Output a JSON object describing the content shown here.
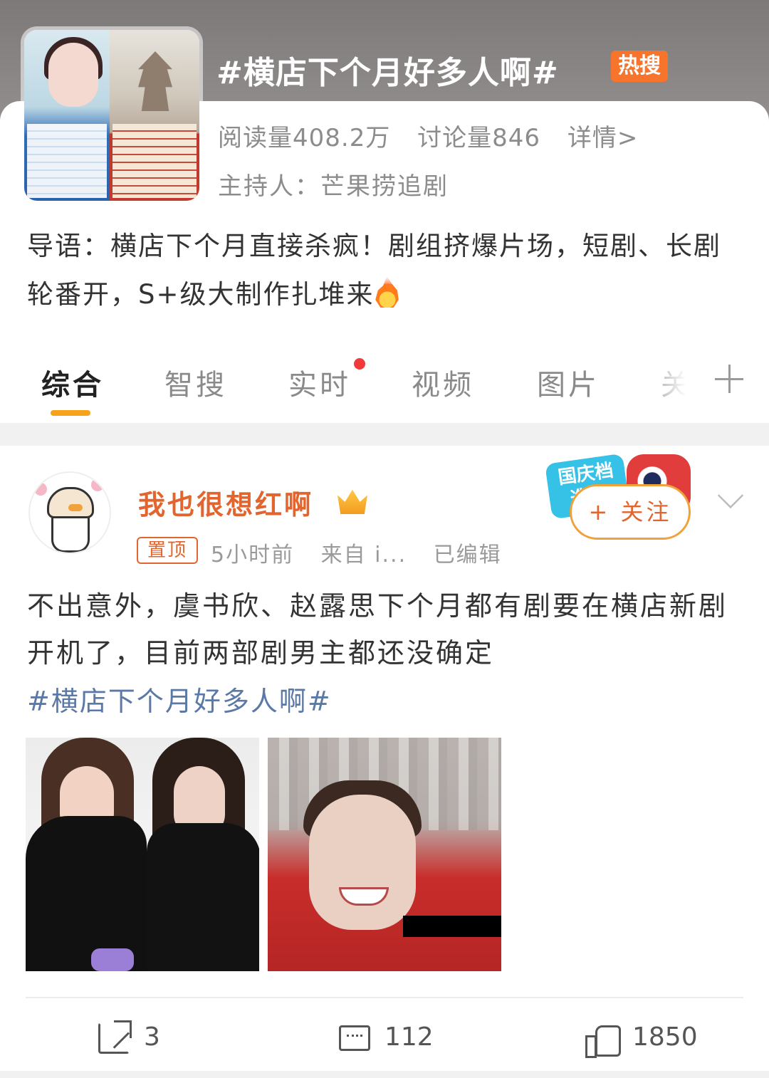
{
  "topic": {
    "title": "#横店下个月好多人啊#",
    "hot_badge": "热搜",
    "reads": "阅读量408.2万",
    "discussions": "讨论量846",
    "details_link": "详情>",
    "host": "主持人：芒果捞追剧",
    "intro": "导语：横店下个月直接杀疯！剧组挤爆片场，短剧、长剧轮番开，S+级大制作扎堆来"
  },
  "tabs": [
    {
      "label": "综合",
      "active": true
    },
    {
      "label": "智搜"
    },
    {
      "label": "实时",
      "has_dot": true
    },
    {
      "label": "视频"
    },
    {
      "label": "图片"
    },
    {
      "label": "关"
    }
  ],
  "post": {
    "username": "我也很想红啊",
    "pinned_label": "置顶",
    "time": "5小时前",
    "source": "来自 i...",
    "edited": "已编辑",
    "follow_label": "+ 关注",
    "promo_text": "国庆档 造梦",
    "text": "不出意外，虞书欣、赵露思下个月都有剧要在横店新剧开机了，目前两部剧男主都还没确定",
    "hashtag": "#横店下个月好多人啊#",
    "actions": {
      "repost_count": "3",
      "comment_count": "112",
      "like_count": "1850"
    }
  },
  "colors": {
    "accent_orange": "#e2652f",
    "hot_badge": "#f7742d",
    "tab_underline": "#f7a21b",
    "hashtag_blue": "#5b79a6"
  },
  "icons": [
    "fire-icon",
    "crown-icon",
    "chevron-down-icon",
    "repost-icon",
    "comment-icon",
    "like-icon",
    "add-tab-icon"
  ]
}
